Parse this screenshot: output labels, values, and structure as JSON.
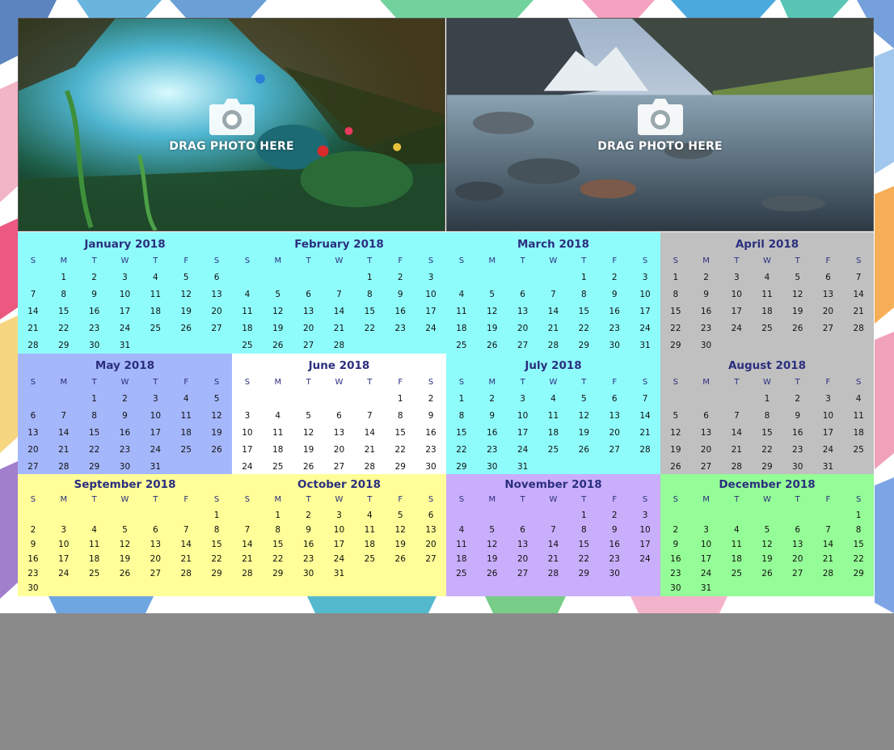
{
  "drop_label": "DRAG PHOTO HERE",
  "photos": [
    {
      "name": "forest-peacock-photo",
      "label": "DRAG PHOTO HERE"
    },
    {
      "name": "mountain-river-photo",
      "label": "DRAG PHOTO HERE"
    }
  ],
  "weekdays": [
    "S",
    "M",
    "T",
    "W",
    "T",
    "F",
    "S"
  ],
  "months": [
    {
      "title": "January 2018",
      "start": 1,
      "days": 31,
      "color": "#8ffcfc"
    },
    {
      "title": "February 2018",
      "start": 4,
      "days": 28,
      "color": "#8ffcfc"
    },
    {
      "title": "March 2018",
      "start": 4,
      "days": 31,
      "color": "#8ffcfc"
    },
    {
      "title": "April 2018",
      "start": 0,
      "days": 30,
      "color": "#c0c0c0"
    },
    {
      "title": "May 2018",
      "start": 2,
      "days": 31,
      "color": "#a5b7fb"
    },
    {
      "title": "June 2018",
      "start": 5,
      "days": 30,
      "color": "#ffffff"
    },
    {
      "title": "July 2018",
      "start": 0,
      "days": 31,
      "color": "#8ffcfc"
    },
    {
      "title": "August 2018",
      "start": 3,
      "days": 31,
      "color": "#c0c0c0"
    },
    {
      "title": "September 2018",
      "start": 6,
      "days": 30,
      "color": "#fffe98"
    },
    {
      "title": "October 2018",
      "start": 1,
      "days": 31,
      "color": "#fffe98"
    },
    {
      "title": "November 2018",
      "start": 4,
      "days": 30,
      "color": "#c9aefc"
    },
    {
      "title": "December 2018",
      "start": 6,
      "days": 31,
      "color": "#95fd97"
    }
  ]
}
